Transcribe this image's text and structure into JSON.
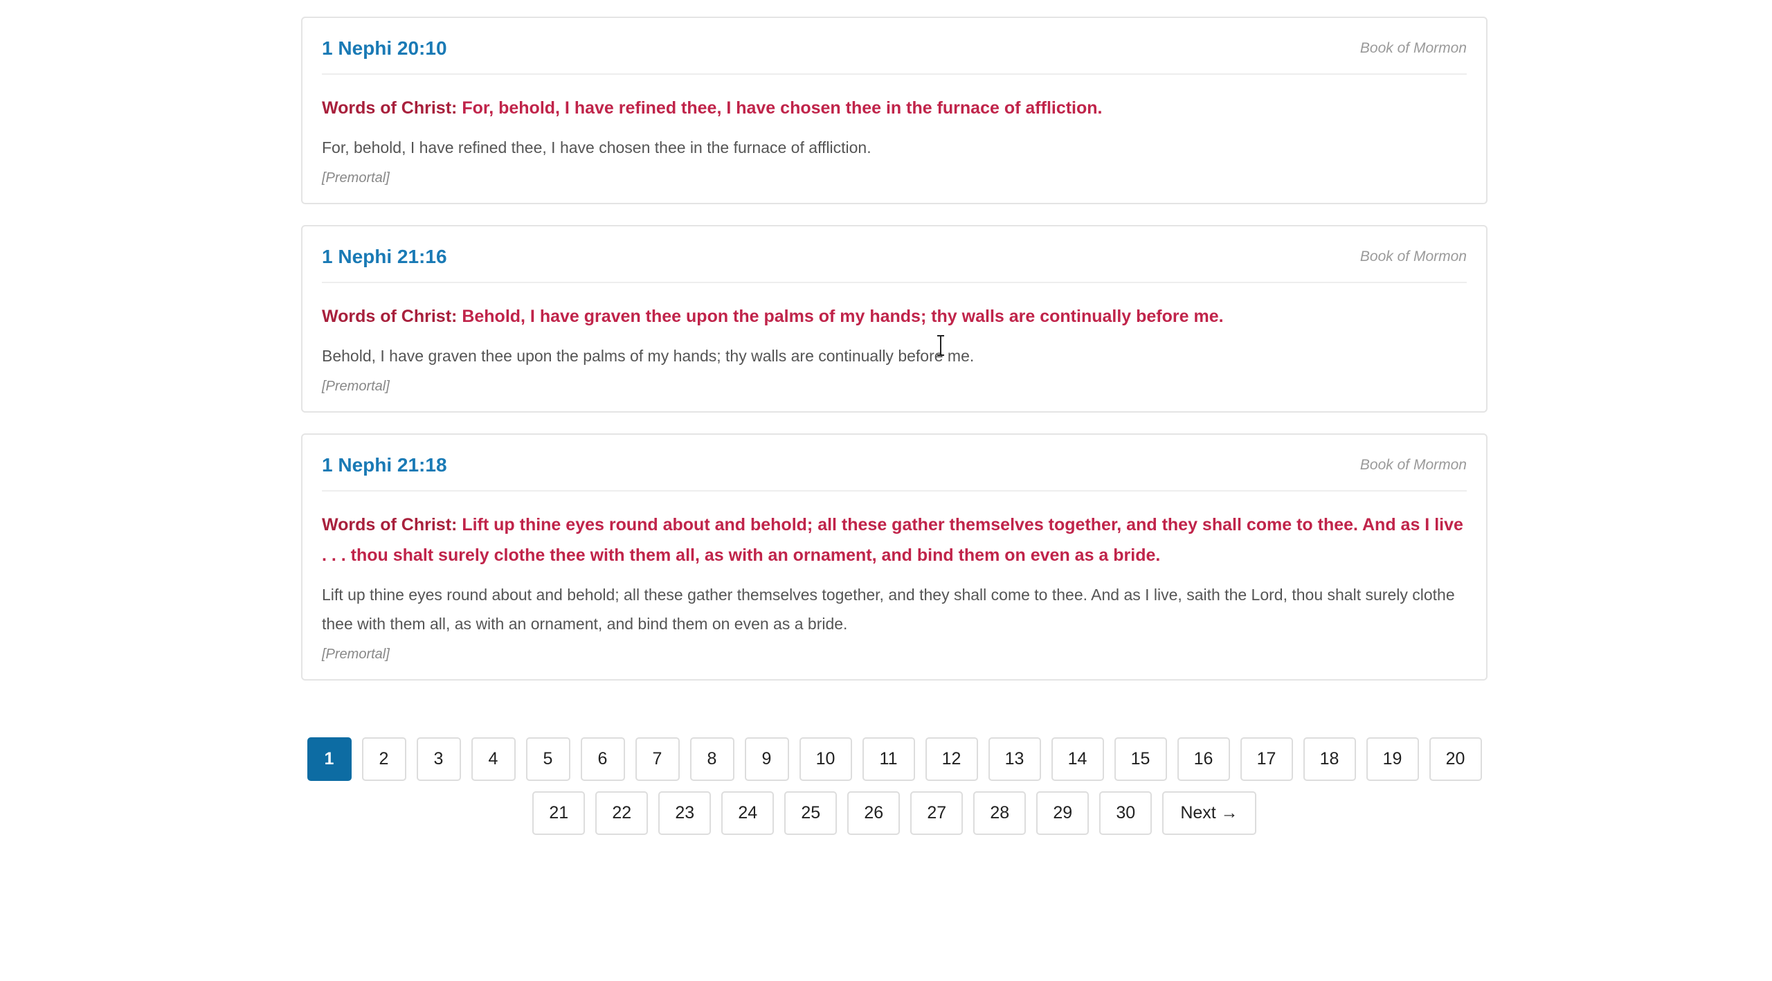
{
  "verses": [
    {
      "reference": "1 Nephi 20:10",
      "source": "Book of Mormon",
      "words_label": "Words of Christ:",
      "words_text": " For, behold, I have refined thee, I have chosen thee in the furnace of affliction.",
      "plain_text": "For, behold, I have refined thee, I have chosen thee in the furnace of affliction.",
      "tag": "[Premortal]"
    },
    {
      "reference": "1 Nephi 21:16",
      "source": "Book of Mormon",
      "words_label": "Words of Christ:",
      "words_text": " Behold, I have graven thee upon the palms of my hands; thy walls are continually before me.",
      "plain_text": "Behold, I have graven thee upon the palms of my hands; thy walls are continually before me.",
      "tag": "[Premortal]"
    },
    {
      "reference": "1 Nephi 21:18",
      "source": "Book of Mormon",
      "words_label": "Words of Christ:",
      "words_text": " Lift up thine eyes round about and behold; all these gather themselves together, and they shall come to thee. And as I live . . . thou shalt surely clothe thee with them all, as with an ornament, and bind them on even as a bride.",
      "plain_text": "Lift up thine eyes round about and behold; all these gather themselves together, and they shall come to thee. And as I live, saith the Lord, thou shalt surely clothe thee with them all, as with an ornament, and bind them on even as a bride.",
      "tag": "[Premortal]"
    }
  ],
  "pagination": {
    "current_page": "1",
    "row1": [
      "1",
      "2",
      "3",
      "4",
      "5",
      "6",
      "7",
      "8",
      "9",
      "10",
      "11",
      "12",
      "13",
      "14",
      "15",
      "16",
      "17",
      "18",
      "19",
      "20"
    ],
    "row2": [
      "21",
      "22",
      "23",
      "24",
      "25",
      "26",
      "27",
      "28",
      "29",
      "30"
    ],
    "next_label": "Next →"
  },
  "colors": {
    "reference_link": "#1a7ab5",
    "words_of_christ": "#c0244a",
    "active_page": "#0d6ca3"
  }
}
